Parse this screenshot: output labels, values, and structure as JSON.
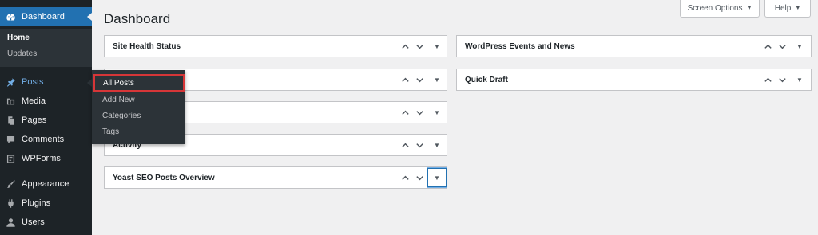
{
  "sidebar": {
    "dashboard": {
      "label": "Dashboard",
      "icon": "dashboard-icon"
    },
    "submenu": {
      "home": "Home",
      "updates": "Updates"
    },
    "items": [
      {
        "label": "Posts",
        "icon": "pin-icon"
      },
      {
        "label": "Media",
        "icon": "media-icon"
      },
      {
        "label": "Pages",
        "icon": "pages-icon"
      },
      {
        "label": "Comments",
        "icon": "comments-icon"
      },
      {
        "label": "WPForms",
        "icon": "wpforms-icon"
      },
      {
        "label": "Appearance",
        "icon": "brush-icon"
      },
      {
        "label": "Plugins",
        "icon": "plugin-icon"
      },
      {
        "label": "Users",
        "icon": "users-icon"
      }
    ]
  },
  "flyout": {
    "items": [
      "All Posts",
      "Add New",
      "Categories",
      "Tags"
    ]
  },
  "header": {
    "title": "Dashboard",
    "screen_options": "Screen Options",
    "help": "Help"
  },
  "widgets": {
    "left": [
      "Site Health Status",
      "",
      "",
      "Activity",
      "Yoast SEO Posts Overview"
    ],
    "right": [
      "WordPress Events and News",
      "Quick Draft"
    ]
  },
  "colors": {
    "sidebar_bg": "#1d2327",
    "accent": "#2271b1",
    "highlight_border": "#d63638"
  }
}
